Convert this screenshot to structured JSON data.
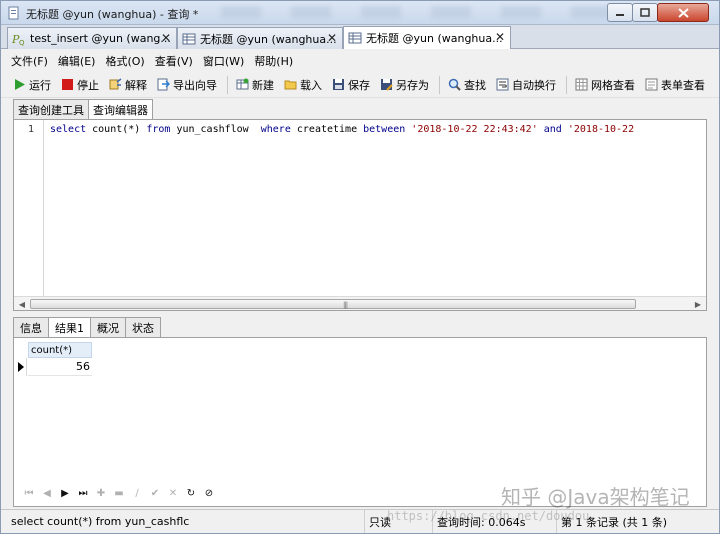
{
  "window": {
    "title": "无标题 @yun (wanghua) - 查询 *"
  },
  "doc_tabs": [
    {
      "label": "test_insert @yun (wang...",
      "icon": "query-p-icon"
    },
    {
      "label": "无标题 @yun (wanghua...",
      "icon": "table-grid-icon"
    },
    {
      "label": "无标题 @yun (wanghua...",
      "icon": "table-grid-icon"
    }
  ],
  "menu": [
    "文件(F)",
    "编辑(E)",
    "格式(O)",
    "查看(V)",
    "窗口(W)",
    "帮助(H)"
  ],
  "toolbar": {
    "run": "运行",
    "stop": "停止",
    "explain": "解释",
    "export_wizard": "导出向导",
    "new": "新建",
    "load": "载入",
    "save": "保存",
    "save_as": "另存为",
    "find": "查找",
    "word_wrap": "自动换行",
    "grid_view": "网格查看",
    "form_view": "表单查看"
  },
  "sub_tabs": [
    "查询创建工具",
    "查询编辑器"
  ],
  "editor": {
    "line_number": "1",
    "tokens": {
      "select": "select",
      "expr": " count(*) ",
      "from": "from",
      "table": " yun_cashflow  ",
      "where": "where",
      "col": " createtime ",
      "between": "between",
      "sp": " ",
      "d1": "'2018-10-22 22:43:42'",
      "and": "and",
      "d2": "'2018-10-22"
    }
  },
  "result_tabs": [
    "信息",
    "结果1",
    "概况",
    "状态"
  ],
  "result": {
    "column": "count(*)",
    "value": "56"
  },
  "status": {
    "sql": "select count(*) from yun_cashflc",
    "mode": "只读",
    "query_time": "查询时间: 0.064s",
    "records": "第 1 条记录 (共 1 条)"
  },
  "watermark": {
    "text": "知乎 @Java架构笔记",
    "url": "https://blog.csdn.net/doudou"
  }
}
